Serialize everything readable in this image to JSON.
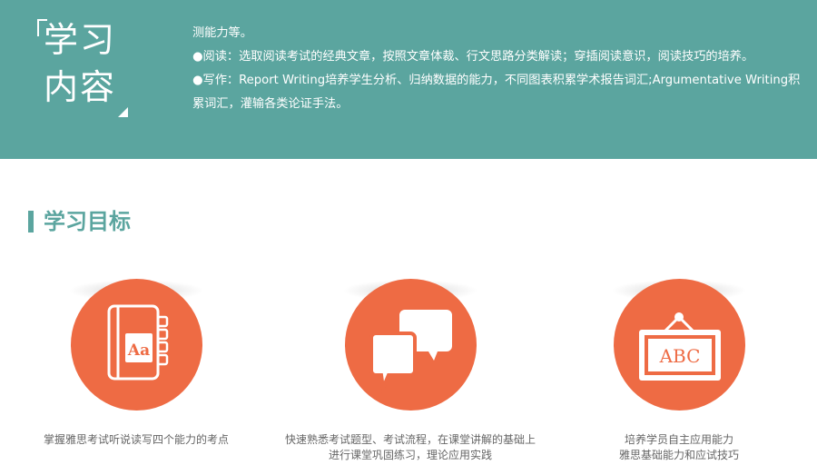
{
  "content_section": {
    "badge_line_1": "学习",
    "badge_line_2": "内容",
    "paragraph_1": "测能力等。",
    "paragraph_2": "●阅读：选取阅读考试的经典文章，按照文章体裁、行文思路分类解读；穿插阅读意识，阅读技巧的培养。",
    "paragraph_3": "●写作：Report Writing培养学生分析、归纳数据的能力，不同图表积累学术报告词汇;Argumentative Writing积累词汇，灌输各类论证手法。"
  },
  "goals_section": {
    "title": "学习目标",
    "items": [
      {
        "icon": "book-icon",
        "icon_text": "Aa",
        "caption_lines": [
          "掌握雅思考试听说读写四个能力的考点"
        ]
      },
      {
        "icon": "speech-bubbles-icon",
        "caption_lines": [
          "快速熟悉考试题型、考试流程，在课堂讲解的基础上",
          "进行课堂巩固练习，理论应用实践"
        ]
      },
      {
        "icon": "abc-board-icon",
        "icon_text": "ABC",
        "caption_lines": [
          "培养学员自主应用能力",
          "雅思基础能力和应试技巧"
        ]
      }
    ]
  },
  "colors": {
    "header_band": "#5ba59f",
    "accent_orange": "#ee6b44",
    "caption_text": "#666666"
  }
}
